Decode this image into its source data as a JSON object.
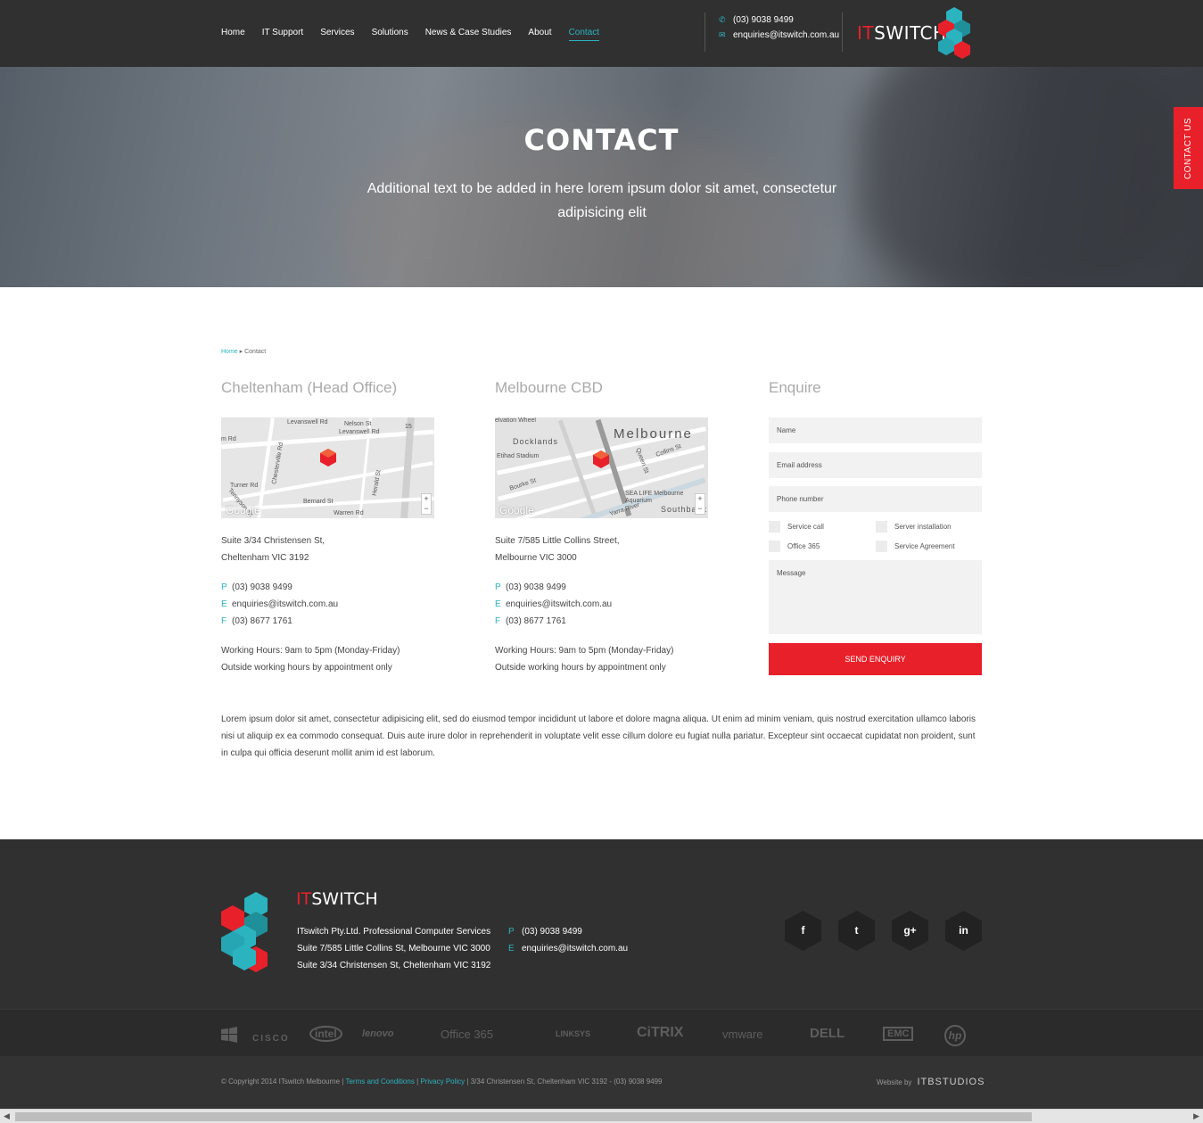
{
  "nav": {
    "items": [
      "Home",
      "IT Support",
      "Services",
      "Solutions",
      "News & Case Studies",
      "About",
      "Contact"
    ],
    "active": "Contact"
  },
  "header": {
    "phone": "(03) 9038 9499",
    "email": "enquiries@itswitch.com.au",
    "logo_it": "IT",
    "logo_switch": "SWITCH"
  },
  "hero": {
    "title": "CONTACT",
    "subtitle": "Additional text to be added in here lorem ipsum dolor sit amet, consectetur adipisicing elit"
  },
  "side_tab": "CONTACT US",
  "breadcrumb": {
    "home": "Home",
    "current": "Contact"
  },
  "offices": [
    {
      "title": "Cheltenham (Head Office)",
      "addr1": "Suite 3/34 Christensen St,",
      "addr2": "Cheltenham VIC 3192",
      "p_label": "P",
      "phone": "(03) 9038 9499",
      "e_label": "E",
      "email": "enquiries@itswitch.com.au",
      "f_label": "F",
      "fax": "(03) 8677 1761",
      "hours1": "Working Hours: 9am to 5pm (Monday-Friday)",
      "hours2": "Outside working hours by appointment only",
      "map_labels": [
        "Levanswell Rd",
        "Nelson St",
        "Levanswell Rd",
        "m Rd",
        "Chesterville Rd",
        "Turner Rd",
        "Bernard St",
        "Herald St",
        "Warren Rd",
        "Tennyson St",
        "15"
      ]
    },
    {
      "title": "Melbourne CBD",
      "addr1": "Suite 7/585 Little Collins Street,",
      "addr2": "Melbourne VIC 3000",
      "p_label": "P",
      "phone": "(03) 9038 9499",
      "e_label": "E",
      "email": "enquiries@itswitch.com.au",
      "f_label": "F",
      "fax": "(03) 8677 1761",
      "hours1": "Working Hours: 9am to 5pm (Monday-Friday)",
      "hours2": "Outside working hours by appointment only",
      "map_labels": [
        "Melbourne",
        "Docklands",
        "Etihad Stadium",
        "Collins St",
        "Queen St",
        "Bourke St",
        "SEA LIFE Melbourne Aquarium",
        "Southbank",
        "Yarra River",
        "elvation Wheel"
      ]
    }
  ],
  "map_google": "Google",
  "enquire": {
    "title": "Enquire",
    "name_placeholder": "Name",
    "email_placeholder": "Email address",
    "phone_placeholder": "Phone number",
    "checkboxes": [
      "Service call",
      "Server installation",
      "Office 365",
      "Service Agreement"
    ],
    "message_placeholder": "Message",
    "submit": "SEND ENQUIRY"
  },
  "paragraph": "Lorem ipsum dolor sit amet, consectetur adipisicing elit, sed do eiusmod tempor incididunt ut labore et dolore magna aliqua. Ut enim ad minim veniam, quis nostrud exercitation ullamco laboris nisi ut aliquip ex ea commodo consequat. Duis aute irure dolor in reprehenderit in voluptate velit esse cillum dolore eu fugiat nulla pariatur. Excepteur sint occaecat cupidatat non proident, sunt in culpa qui officia deserunt mollit anim id est laborum.",
  "footer": {
    "logo_it": "IT",
    "logo_switch": "SWITCH",
    "line1": "ITswitch Pty.Ltd. Professional Computer Services",
    "line2": "Suite 7/585 Little Collins St, Melbourne VIC 3000",
    "line3": "Suite 3/34 Christensen St, Cheltenham VIC 3192",
    "p_label": "P",
    "phone": "(03) 9038 9499",
    "e_label": "E",
    "email": "enquiries@itswitch.com.au",
    "social": [
      "f",
      "t",
      "g+",
      "in"
    ]
  },
  "partners": [
    "CISCO",
    "intel",
    "lenovo",
    "Office 365",
    "LINKSYS",
    "CiTRIX",
    "vmware",
    "DELL",
    "EMC",
    "hp"
  ],
  "bottom": {
    "copyright": "© Copyright 2014 ITswitch Melbourne |",
    "terms": "Terms and Conditions",
    "sep": "|",
    "privacy": "Privacy Policy",
    "address": "| 3/34 Christensen St, Cheltenham VIC 3192 - (03) 9038 9499",
    "website_by": "Website by",
    "studio": "ITBSTUDIOS"
  },
  "colors": {
    "accent_red": "#e8202a",
    "accent_teal": "#2bb3c0",
    "dark": "#303030"
  }
}
